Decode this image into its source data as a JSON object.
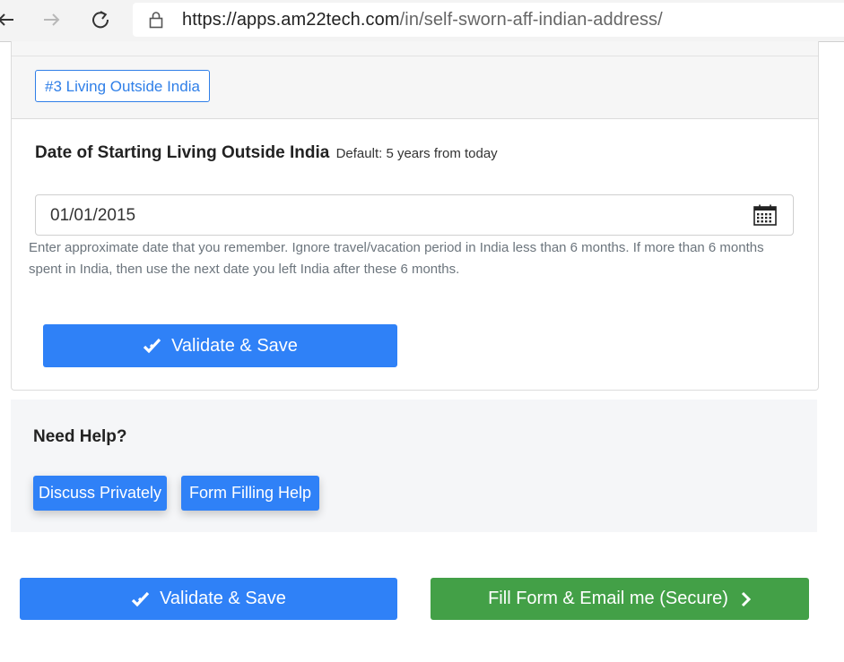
{
  "browser": {
    "url_host": "https://apps.am22tech.com",
    "url_path": "/in/self-sworn-aff-indian-address/"
  },
  "section": {
    "tag": "#3 Living Outside India",
    "field_title": "Date of Starting Living Outside India",
    "field_hint": "Default: 5 years from today",
    "date_value": "01/01/2015",
    "help_text": "Enter approximate date that you remember. Ignore travel/vacation period in India less than 6 months. If more than 6 months spent in India, then use the next date you left India after these 6 months.",
    "validate_label": "Validate & Save"
  },
  "help": {
    "heading": "Need Help?",
    "discuss_label": "Discuss Privately",
    "form_help_label": "Form Filling Help"
  },
  "footer": {
    "validate_label": "Validate & Save",
    "fill_email_label": "Fill Form & Email me (Secure)"
  },
  "colors": {
    "primary": "#2f81f7",
    "success": "#43a047",
    "panel_bg": "#f5f6f8"
  }
}
